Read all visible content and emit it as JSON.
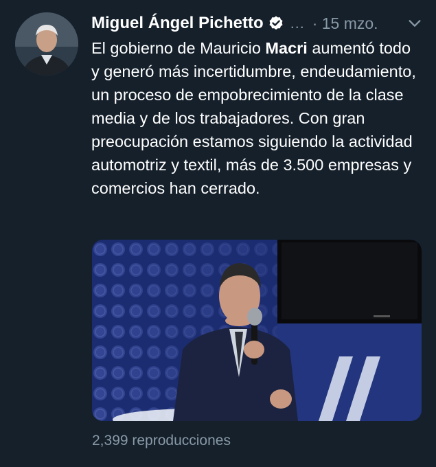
{
  "tweet": {
    "author_name": "Miguel Ángel Pichetto",
    "more_glyph": "…",
    "date": "· 15 mzo.",
    "text_before": "El gobierno de Mauricio ",
    "text_bold": "Macri",
    "text_after": " aumentó todo y generó más incertidumbre, endeudamiento, un proceso de empobrecimiento de la clase media y de los trabajadores. Con gran preocupación estamos siguiendo la actividad automotriz y textil, más de 3.500 empresas y comercios han cerrado.",
    "views": "2,399 reproducciones"
  },
  "icons": {
    "verified": "verified-badge-icon",
    "chevron": "chevron-down-icon"
  },
  "colors": {
    "background": "#15202b",
    "muted_text": "#8899a6",
    "media_blue": "#1c2c70"
  }
}
